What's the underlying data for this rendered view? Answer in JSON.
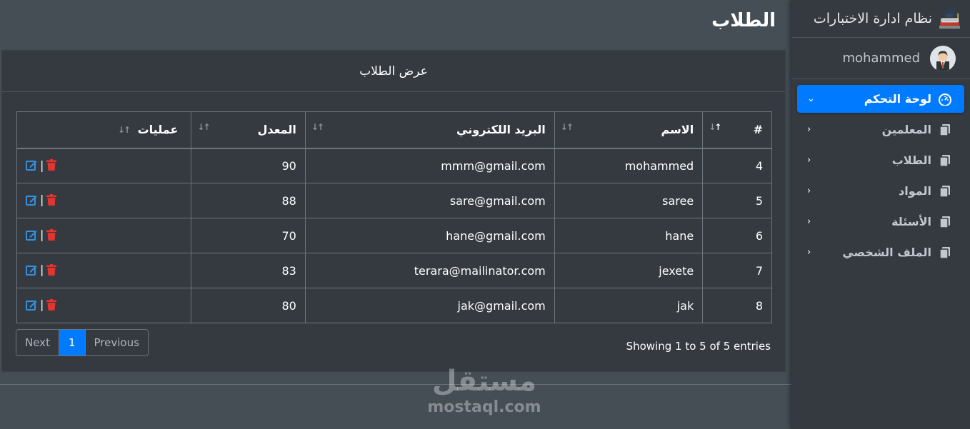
{
  "sidebar": {
    "brand": "نظام ادارة الاختبارات",
    "user": "mohammed",
    "items": [
      {
        "label": "لوحة التحكم",
        "icon": "dashboard-icon",
        "active": true,
        "chevron": "⌄"
      },
      {
        "label": "المعلمين",
        "icon": "copy-icon",
        "active": false,
        "chevron": "‹"
      },
      {
        "label": "الطلاب",
        "icon": "copy-icon",
        "active": false,
        "chevron": "‹"
      },
      {
        "label": "المواد",
        "icon": "copy-icon",
        "active": false,
        "chevron": "‹"
      },
      {
        "label": "الأسئلة",
        "icon": "copy-icon",
        "active": false,
        "chevron": "‹"
      },
      {
        "label": "الملف الشخصي",
        "icon": "copy-icon",
        "active": false,
        "chevron": "‹"
      }
    ]
  },
  "page": {
    "title": "الطلاب",
    "card_title": "عرض الطلاب"
  },
  "table": {
    "headers": [
      "#",
      "الاسم",
      "البريد اللكتروني",
      "المعدل",
      "عمليات"
    ],
    "rows": [
      {
        "id": "4",
        "name": "mohammed",
        "email": "mmm@gmail.com",
        "avg": "90"
      },
      {
        "id": "5",
        "name": "saree",
        "email": "sare@gmail.com",
        "avg": "88"
      },
      {
        "id": "6",
        "name": "hane",
        "email": "hane@gmail.com",
        "avg": "70"
      },
      {
        "id": "7",
        "name": "jexete",
        "email": "terara@mailinator.com",
        "avg": "83"
      },
      {
        "id": "8",
        "name": "jak",
        "email": "jak@gmail.com",
        "avg": "80"
      }
    ]
  },
  "footer": {
    "showing": "Showing 1 to 5 of 5 entries",
    "pagination": {
      "next": "Next",
      "current": "1",
      "previous": "Previous"
    }
  },
  "watermark": {
    "arabic": "مستقل",
    "latin": "mostaql.com"
  },
  "colors": {
    "accent": "#007bff",
    "danger": "#e3342f",
    "sidebar": "#343a40",
    "content": "#454d55"
  }
}
